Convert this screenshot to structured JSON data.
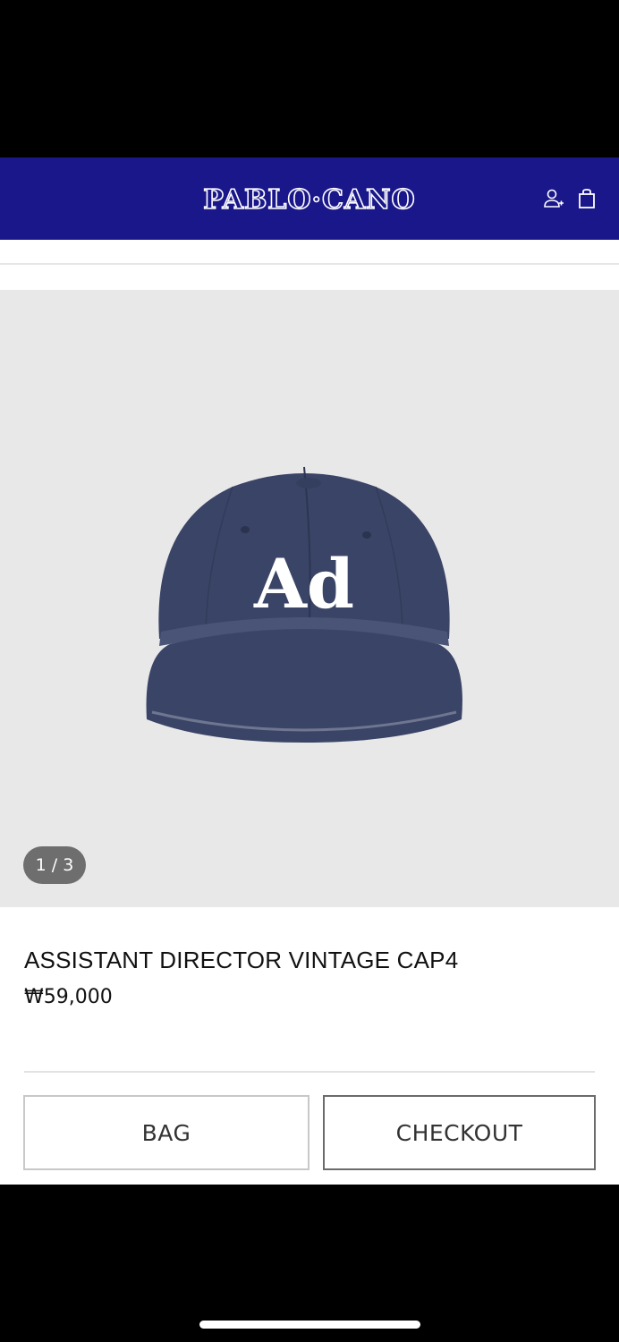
{
  "header": {
    "logo": "PABLO·CANO",
    "account_icon": "account-icon",
    "bag_icon": "shopping-bag-icon",
    "background": "#1a178a"
  },
  "gallery": {
    "cap_text": "Ad",
    "counter": "1 / 3"
  },
  "product": {
    "name": "ASSISTANT DIRECTOR VINTAGE CAP4",
    "price": "₩59,000"
  },
  "actions": {
    "bag_label": "BAG",
    "checkout_label": "CHECKOUT"
  }
}
